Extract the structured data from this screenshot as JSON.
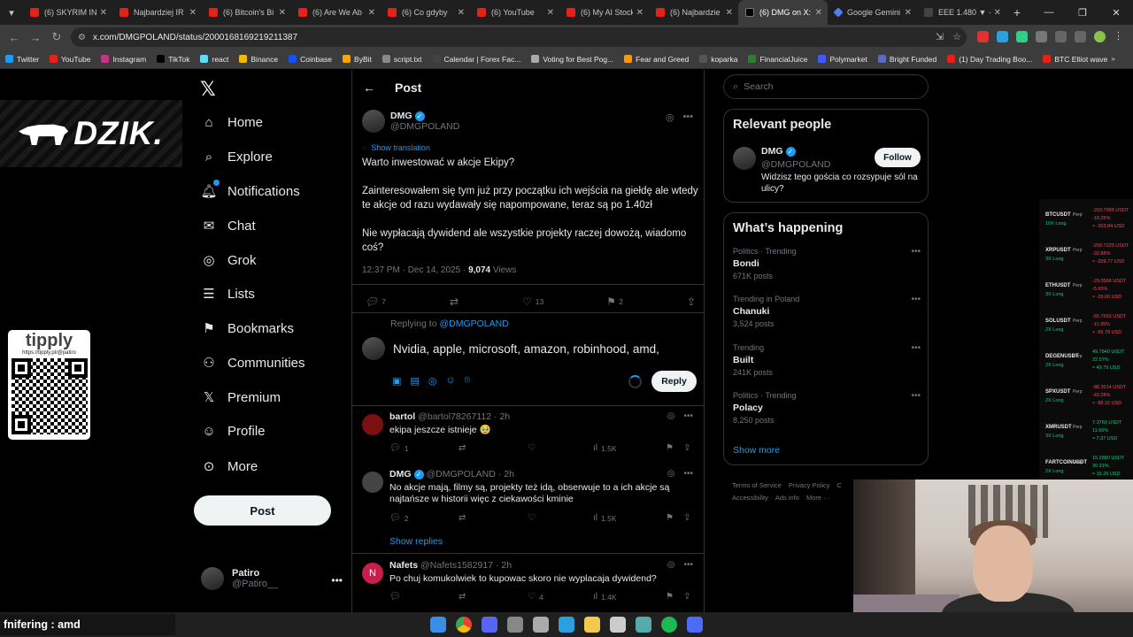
{
  "browser": {
    "tabs": [
      {
        "title": "(6) SKYRIM IN",
        "icon": "youtube-icon"
      },
      {
        "title": "Najbardziej IR",
        "icon": "youtube-icon"
      },
      {
        "title": "(6) Bitcoin's Bi",
        "icon": "youtube-icon"
      },
      {
        "title": "(6) Are We Ab",
        "icon": "youtube-icon"
      },
      {
        "title": "(6) Co gdyby",
        "icon": "youtube-icon"
      },
      {
        "title": "(6) YouTube",
        "icon": "youtube-icon"
      },
      {
        "title": "(6) My AI Stock",
        "icon": "youtube-icon"
      },
      {
        "title": "(6) Najbardzie",
        "icon": "youtube-icon"
      },
      {
        "title": "(6) DMG on X:",
        "icon": "x-icon",
        "active": true
      },
      {
        "title": "Google Gemini",
        "icon": "gemini-icon"
      },
      {
        "title": "EEE 1.480 ▼ -",
        "icon": "chart-icon"
      }
    ],
    "url": "x.com/DMGPOLAND/status/2000168169219211387",
    "bookmarks": [
      "Twitter",
      "YouTube",
      "Instagram",
      "TikTok",
      "react",
      "Binance",
      "Coinbase",
      "ByBit",
      "script.txt",
      "Calendar | Forex Fac...",
      "Voting for Best Pog...",
      "Fear and Greed",
      "koparka",
      "FinancialJuice",
      "Polymarket",
      "Bright Funded",
      "(1) Day Trading Boo...",
      "BTC Elliot wave"
    ]
  },
  "overlay": {
    "brand": "DZIK.",
    "tipply_title": "tipply",
    "tipply_url": "https://tipply.pl/@patiro",
    "chat_message": "fnifering : amd"
  },
  "nav": {
    "items": [
      {
        "label": "Home",
        "icon": "home-icon"
      },
      {
        "label": "Explore",
        "icon": "search-icon"
      },
      {
        "label": "Notifications",
        "icon": "bell-icon"
      },
      {
        "label": "Chat",
        "icon": "mail-icon"
      },
      {
        "label": "Grok",
        "icon": "grok-icon"
      },
      {
        "label": "Lists",
        "icon": "list-icon"
      },
      {
        "label": "Bookmarks",
        "icon": "bookmark-icon"
      },
      {
        "label": "Communities",
        "icon": "communities-icon"
      },
      {
        "label": "Premium",
        "icon": "x-icon"
      },
      {
        "label": "Profile",
        "icon": "person-icon"
      },
      {
        "label": "More",
        "icon": "more-circle-icon"
      }
    ],
    "post_button": "Post",
    "account": {
      "name": "Patiro",
      "handle": "@Patiro__"
    }
  },
  "post": {
    "header": "Post",
    "author_name": "DMG",
    "author_handle": "@DMGPOLAND",
    "show_translation": "Show translation",
    "paragraphs": [
      "Warto inwestować w akcje Ekipy?",
      "Zainteresowałem się tym już przy początku ich wejścia na giełdę ale wtedy te akcje od razu wydawały się napompowane, teraz są po 1.40zł",
      "Nie wypłacają dywidend ale wszystkie projekty raczej dowożą, wiadomo coś?"
    ],
    "time": "12:37 PM · Dec 14, 2025 · ",
    "views_count": "9,074",
    "views_label": " Views",
    "replies": "7",
    "likes": "13",
    "bookmarks": "2",
    "replying_to_label": "Replying to ",
    "replying_to": "@DMGPOLAND",
    "draft": "Nvidia, apple, microsoft, amazon, robinhood, amd,",
    "reply_button": "Reply"
  },
  "replies": [
    {
      "name": "bartol",
      "handle": "@bartol78267112",
      "time": "· 2h",
      "text": "ekipa jeszcze istnieje 🥹",
      "replies": "1",
      "retweets": "",
      "likes": "",
      "views": "1.5K"
    },
    {
      "name": "DMG",
      "handle": "@DMGPOLAND",
      "time": "· 2h",
      "text": "No akcje mają, filmy są, projekty też idą, obserwuje to a ich akcje są najtańsze w historii więc z ciekawości kminie",
      "replies": "2",
      "retweets": "",
      "likes": "",
      "views": "1.5K",
      "verified": true
    },
    {
      "name": "Nafets",
      "handle": "@Nafets1582917",
      "time": "· 2h",
      "text": "Po chuj komukolwiek to kupowac skoro nie wyplacaja dywidend?",
      "replies": "",
      "retweets": "",
      "likes": "4",
      "views": "1.4K"
    }
  ],
  "show_replies": "Show replies",
  "sidebar": {
    "search_placeholder": "Search",
    "relevant_title": "Relevant people",
    "relevant": {
      "name": "DMG",
      "handle": "@DMGPOLAND",
      "bio": "Widzisz tego gościa co rozsypuje sól na ulicy?",
      "follow": "Follow"
    },
    "happening_title": "What’s happening",
    "trends": [
      {
        "category": "Politics · Trending",
        "title": "Bondi",
        "posts": "671K posts"
      },
      {
        "category": "Trending in Poland",
        "title": "Chanuki",
        "posts": "3,524 posts"
      },
      {
        "category": "Trending",
        "title": "Built",
        "posts": "241K posts"
      },
      {
        "category": "Politics · Trending",
        "title": "Polacy",
        "posts": "8,250 posts"
      }
    ],
    "show_more": "Show more",
    "footer": [
      "Terms of Service",
      "Privacy Policy",
      "C",
      "Accessibility",
      "Ads info",
      "More ···"
    ]
  },
  "crypto": [
    {
      "sym": "BTCUSDT",
      "lev": "10X Long",
      "v1": "-203.7995 USDT",
      "v2": "-18.25%",
      "v3": "≈ -203.84 USD",
      "dir": "neg"
    },
    {
      "sym": "XRPUSDT",
      "lev": "3X Long",
      "v1": "-209.7225 USDT",
      "v2": "-32.88%",
      "v3": "≈ -209.77 USD",
      "dir": "neg"
    },
    {
      "sym": "ETHUSDT",
      "lev": "3X Long",
      "v1": "-29.0568 USDT",
      "v2": "-5.65%",
      "v3": "≈ -29.06 USD",
      "dir": "neg"
    },
    {
      "sym": "SOLUSDT",
      "lev": "2X Long",
      "v1": "-55.7693 USDT",
      "v2": "-11.95%",
      "v3": "≈ -55.78 USD",
      "dir": "neg"
    },
    {
      "sym": "DEGENUSDT",
      "lev": "2X Long",
      "v1": "49.7840 USDT",
      "v2": "22.57%",
      "v3": "≈ 49.79 USD",
      "dir": "pos"
    },
    {
      "sym": "SPXUSDT",
      "lev": "2X Long",
      "v1": "-88.3014 USDT",
      "v2": "-43.28%",
      "v3": "≈ -88.32 USD",
      "dir": "neg"
    },
    {
      "sym": "XMRUSDT",
      "lev": "3X Long",
      "v1": "7.3760 USDT",
      "v2": "11.66%",
      "v3": "≈ 7.37 USD",
      "dir": "pos"
    },
    {
      "sym": "FARTCOINUSDT",
      "lev": "2X Long",
      "v1": "15.2880 USDT",
      "v2": "30.91%",
      "v3": "≈ 15.29 USD",
      "dir": "pos"
    }
  ],
  "colors": {
    "accent": "#1d9bf0",
    "positive": "#0ecb81",
    "negative": "#f6465d"
  }
}
